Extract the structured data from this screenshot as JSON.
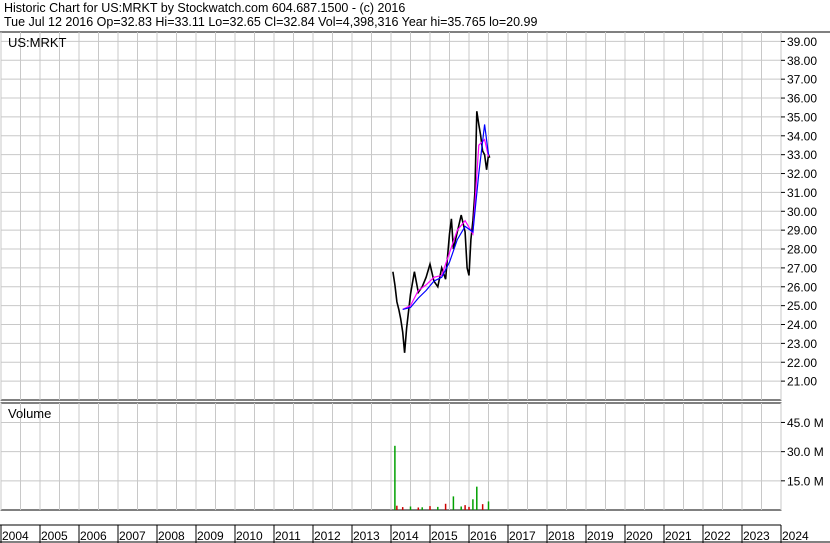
{
  "header": {
    "line1": "Historic Chart for US:MRKT by Stockwatch.com 604.687.1500 - (c) 2016",
    "line2": "Tue Jul 12 2016   Op=32.83   Hi=33.11   Lo=32.65   Cl=32.84   Vol=4,398,316   Year hi=35.765   lo=20.99"
  },
  "colors": {
    "price": "#000000",
    "ma_short": "#ff00ff",
    "ma_long": "#0000ff",
    "vol_up": "#00a000",
    "vol_down": "#cc0000",
    "grid": "#c8c8c8"
  },
  "chart_data": [
    {
      "type": "line",
      "label": "US:MRKT",
      "y_ticks": [
        "21.00",
        "22.00",
        "23.00",
        "24.00",
        "25.00",
        "26.00",
        "27.00",
        "28.00",
        "29.00",
        "30.00",
        "31.00",
        "32.00",
        "33.00",
        "34.00",
        "35.00",
        "36.00",
        "37.00",
        "38.00",
        "39.00"
      ],
      "ylim": [
        20.0,
        39.5
      ],
      "x_ticks": [
        "2004",
        "2005",
        "2006",
        "2007",
        "2008",
        "2009",
        "2010",
        "2011",
        "2012",
        "2013",
        "2014",
        "2015",
        "2016",
        "2017",
        "2018",
        "2019",
        "2020",
        "2021",
        "2022",
        "2023",
        "2024"
      ],
      "xlim": [
        2004.0,
        2024.0
      ],
      "grid": true,
      "series": [
        {
          "x": [
            2014.05,
            2014.1,
            2014.15,
            2014.2,
            2014.25,
            2014.3,
            2014.35,
            2014.4,
            2014.5,
            2014.6,
            2014.7,
            2014.8,
            2014.9,
            2015.0,
            2015.1,
            2015.2,
            2015.3,
            2015.4,
            2015.5,
            2015.55,
            2015.6,
            2015.7,
            2015.8,
            2015.9,
            2015.95,
            2016.0,
            2016.05,
            2016.1,
            2016.15,
            2016.2,
            2016.25,
            2016.3,
            2016.35,
            2016.4,
            2016.45,
            2016.5,
            2016.53
          ],
          "values": [
            26.8,
            26.1,
            25.2,
            24.8,
            24.3,
            23.6,
            22.5,
            23.8,
            25.6,
            26.8,
            25.7,
            26.0,
            26.5,
            27.2,
            26.3,
            26.0,
            27.0,
            26.4,
            28.8,
            29.6,
            28.0,
            28.9,
            29.8,
            28.9,
            27.0,
            26.6,
            28.5,
            29.5,
            31.0,
            35.3,
            34.6,
            34.0,
            33.2,
            33.0,
            32.2,
            33.0,
            32.84
          ]
        },
        {
          "x": [
            2014.3,
            2014.5,
            2014.7,
            2014.9,
            2015.1,
            2015.3,
            2015.5,
            2015.7,
            2015.9,
            2016.1,
            2016.25,
            2016.4,
            2016.5
          ],
          "values": [
            24.8,
            25.0,
            25.8,
            26.1,
            26.5,
            26.6,
            27.8,
            29.0,
            29.5,
            28.8,
            33.5,
            33.8,
            32.9
          ]
        },
        {
          "x": [
            2014.3,
            2014.5,
            2014.7,
            2014.9,
            2015.1,
            2015.3,
            2015.5,
            2015.7,
            2015.9,
            2016.1,
            2016.25,
            2016.4,
            2016.5
          ],
          "values": [
            24.8,
            24.9,
            25.4,
            25.8,
            26.3,
            26.5,
            27.3,
            28.5,
            29.2,
            28.9,
            32.0,
            34.6,
            33.0
          ]
        }
      ]
    },
    {
      "type": "bar",
      "label": "Volume",
      "y_ticks": [
        "15.0 M",
        "30.0 M",
        "45.0 M"
      ],
      "ylim": [
        0,
        55
      ],
      "xlim": [
        2004.0,
        2024.0
      ],
      "grid": true,
      "x": [
        2014.1,
        2014.15,
        2014.3,
        2014.5,
        2014.7,
        2014.8,
        2015.0,
        2015.2,
        2015.4,
        2015.6,
        2015.8,
        2015.9,
        2016.0,
        2016.1,
        2016.2,
        2016.35,
        2016.5
      ],
      "values": [
        33,
        2.2,
        1.5,
        1.8,
        1.3,
        1.4,
        2.0,
        1.6,
        3.2,
        7.0,
        1.8,
        2.5,
        1.6,
        5.5,
        12.0,
        3.0,
        4.4
      ],
      "colors": [
        "up",
        "down",
        "down",
        "up",
        "down",
        "up",
        "down",
        "up",
        "down",
        "up",
        "up",
        "down",
        "down",
        "up",
        "up",
        "down",
        "up"
      ]
    }
  ]
}
